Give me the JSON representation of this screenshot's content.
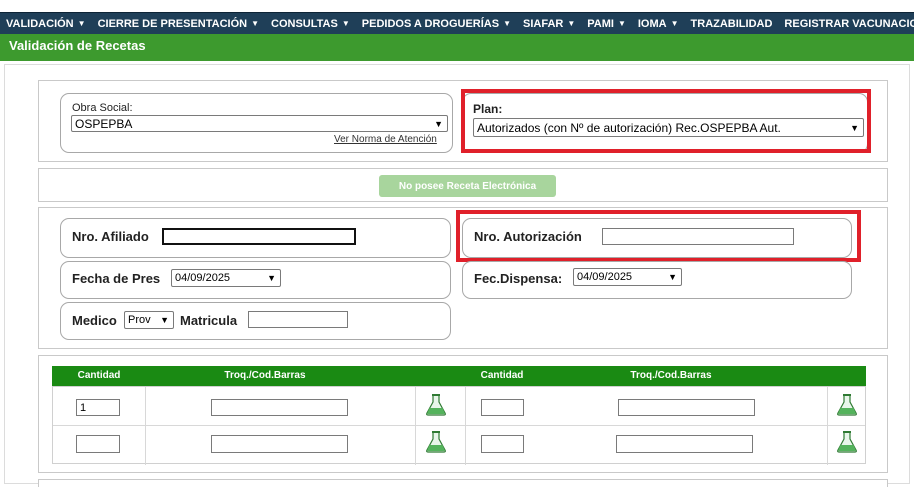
{
  "nav": {
    "items": [
      {
        "label": "VALIDACIÓN",
        "chevron": true
      },
      {
        "label": "CIERRE DE PRESENTACIÓN",
        "chevron": true
      },
      {
        "label": "CONSULTAS",
        "chevron": true
      },
      {
        "label": "PEDIDOS A DROGUERÍAS",
        "chevron": true
      },
      {
        "label": "SIAFAR",
        "chevron": true
      },
      {
        "label": "PAMI",
        "chevron": true
      },
      {
        "label": "IOMA",
        "chevron": true
      },
      {
        "label": "TRAZABILIDAD",
        "chevron": false
      },
      {
        "label": "REGISTRAR VACUNACION",
        "chevron": false
      }
    ]
  },
  "page": {
    "title": "Validación de Recetas"
  },
  "obra_social": {
    "label": "Obra Social:",
    "value": "OSPEPBA",
    "link": "Ver Norma de Atención"
  },
  "plan": {
    "label": "Plan:",
    "value": "Autorizados (con Nº de autorización) Rec.OSPEPBA Aut."
  },
  "receta_button": {
    "label": "No posee Receta Electrónica"
  },
  "form": {
    "afiliado_label": "Nro. Afiliado",
    "afiliado_value": "",
    "autorizacion_label": "Nro. Autorización",
    "autorizacion_value": "",
    "fecha_pres_label": "Fecha de Pres",
    "fecha_pres_value": "04/09/2025",
    "fec_dispensa_label": "Fec.Dispensa:",
    "fec_dispensa_value": "04/09/2025",
    "medico_label": "Medico",
    "medico_type": "Prov",
    "matricula_label": "Matricula",
    "matricula_value": ""
  },
  "table": {
    "headers": [
      "Cantidad",
      "Troq./Cod.Barras",
      "Cantidad",
      "Troq./Cod.Barras"
    ],
    "rows": [
      {
        "cant1": "1",
        "troq1": "",
        "cant2": "",
        "troq2": ""
      },
      {
        "cant1": "",
        "troq1": "",
        "cant2": "",
        "troq2": ""
      }
    ]
  },
  "colors": {
    "nav_bg": "#1f3f58",
    "title_bar": "#3d9a2e",
    "table_header": "#1a8a13",
    "highlight": "#e0202a"
  },
  "icons": {
    "nav_dropdown": "chevron-down-icon",
    "product_search": "flask-icon"
  }
}
